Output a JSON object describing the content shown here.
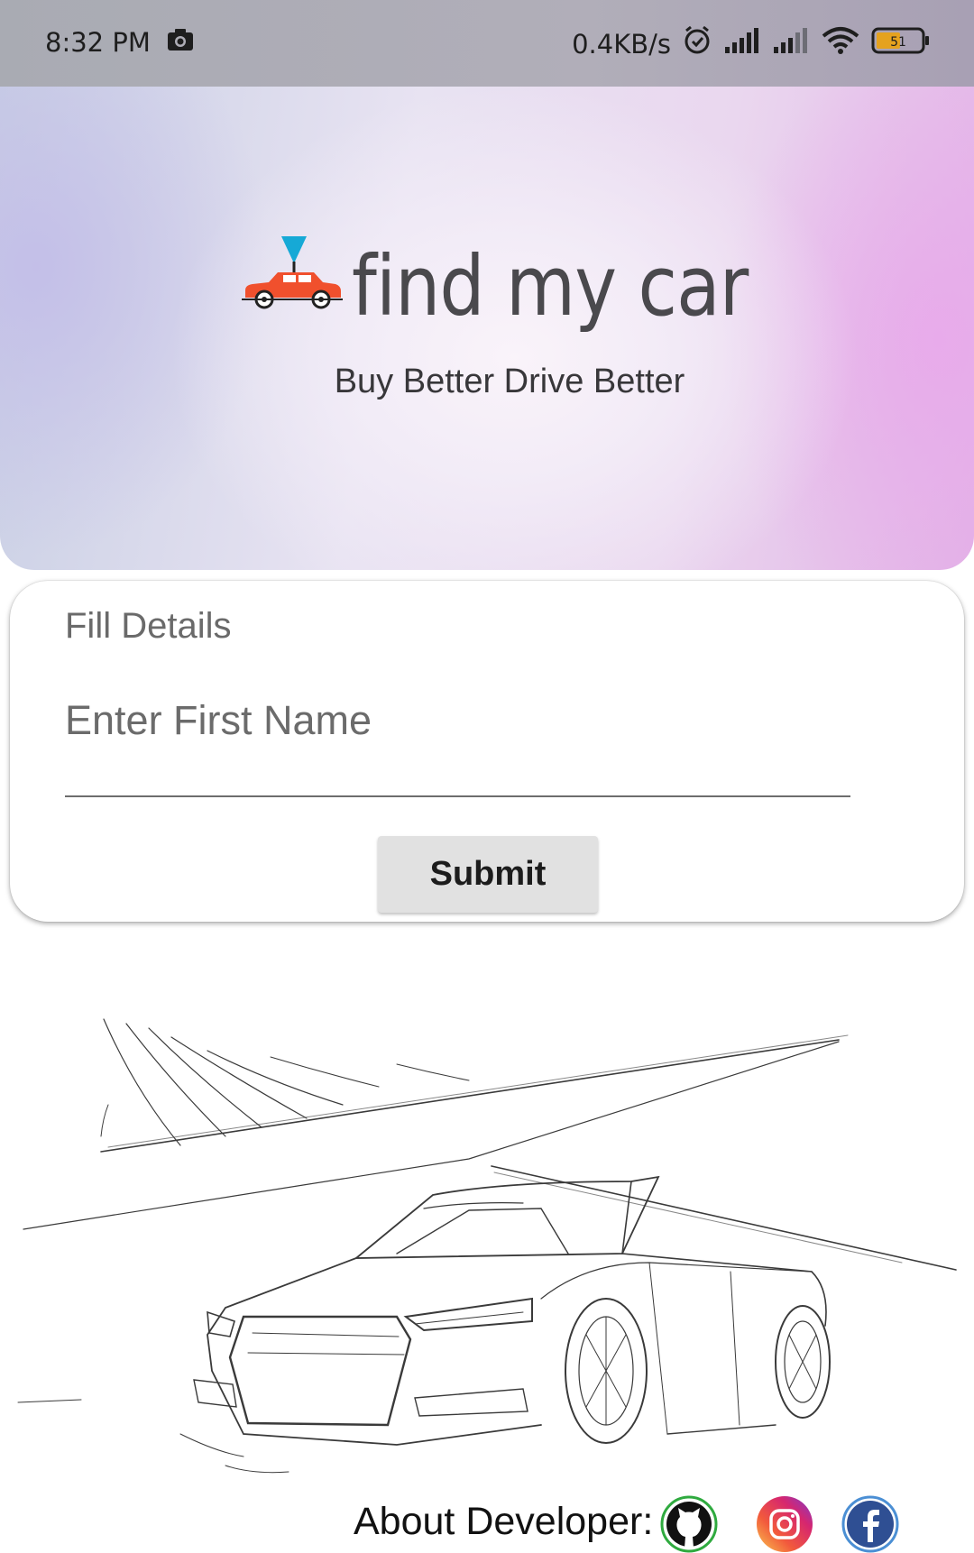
{
  "status_bar": {
    "time": "8:32 PM",
    "net_speed": "0.4KB/s",
    "battery": "51",
    "icons": [
      "camera-icon",
      "alarm-icon",
      "signal-icon",
      "signal-icon",
      "wifi-icon",
      "battery-icon"
    ]
  },
  "hero": {
    "app_name": "find my car",
    "tagline": "Buy Better Drive Better",
    "colors": {
      "car": "#f0502d",
      "pin": "#16a9d6",
      "text": "#4a494d"
    }
  },
  "form": {
    "title": "Fill Details",
    "first_name_placeholder": "Enter First Name",
    "first_name_value": "",
    "submit_label": "Submit"
  },
  "footer": {
    "about_label": "About Developer:",
    "links": [
      {
        "name": "github",
        "icon": "github-icon"
      },
      {
        "name": "instagram",
        "icon": "instagram-icon"
      },
      {
        "name": "facebook",
        "icon": "facebook-icon"
      }
    ]
  }
}
